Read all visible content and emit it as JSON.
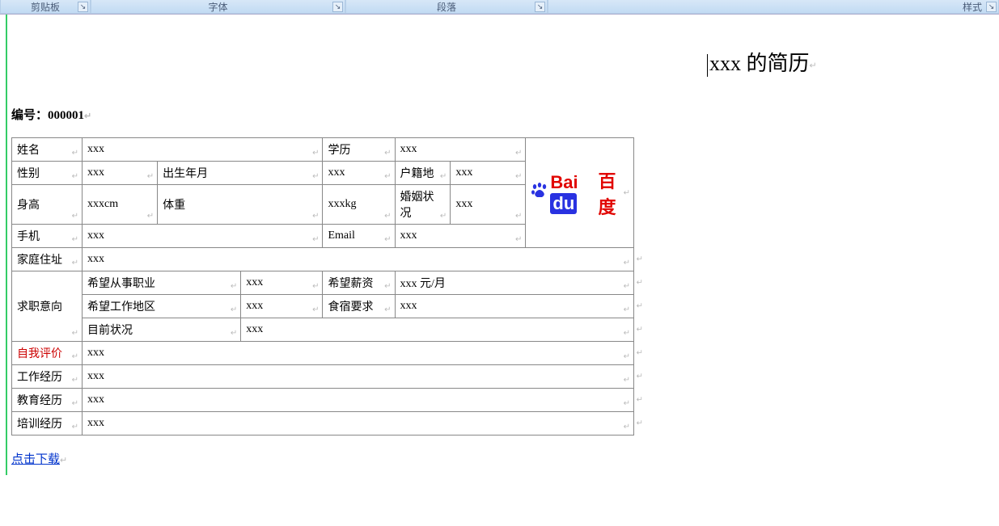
{
  "ribbon": {
    "clipboard": "剪贴板",
    "font": "字体",
    "paragraph": "段落",
    "styles": "样式"
  },
  "title": "xxx 的简历",
  "serial_label": "编号：",
  "serial_value": "000001",
  "labels": {
    "name": "姓名",
    "edu": "学历",
    "gender": "性别",
    "birth": "出生年月",
    "hukou": "户籍地",
    "height": "身高",
    "weight": "体重",
    "marriage": "婚姻状况",
    "phone": "手机",
    "email": "Email",
    "addr": "家庭住址",
    "job_intent": "求职意向",
    "desired_job": "希望从事职业",
    "desired_salary": "希望薪资",
    "desired_area": "希望工作地区",
    "board": "食宿要求",
    "cur_status": "目前状况",
    "self_eval": "自我评价",
    "work_exp": "工作经历",
    "edu_exp": "教育经历",
    "train_exp": "培训经历"
  },
  "values": {
    "name": "xxx",
    "edu": "xxx",
    "gender": "xxx",
    "birth": "xxx",
    "hukou": "xxx",
    "height": "xxxcm",
    "weight": "xxxkg",
    "marriage": "xxx",
    "phone": "xxx",
    "email": "xxx",
    "addr": "xxx",
    "desired_job": "xxx",
    "desired_salary": "xxx 元/月",
    "desired_area": "xxx",
    "board": "xxx",
    "cur_status": "xxx",
    "self_eval": "xxx",
    "work_exp": "xxx",
    "edu_exp": "xxx",
    "train_exp": "xxx"
  },
  "download": "点击下载",
  "logo": {
    "bai": "Bai",
    "du": "du",
    "cn": "百度"
  }
}
